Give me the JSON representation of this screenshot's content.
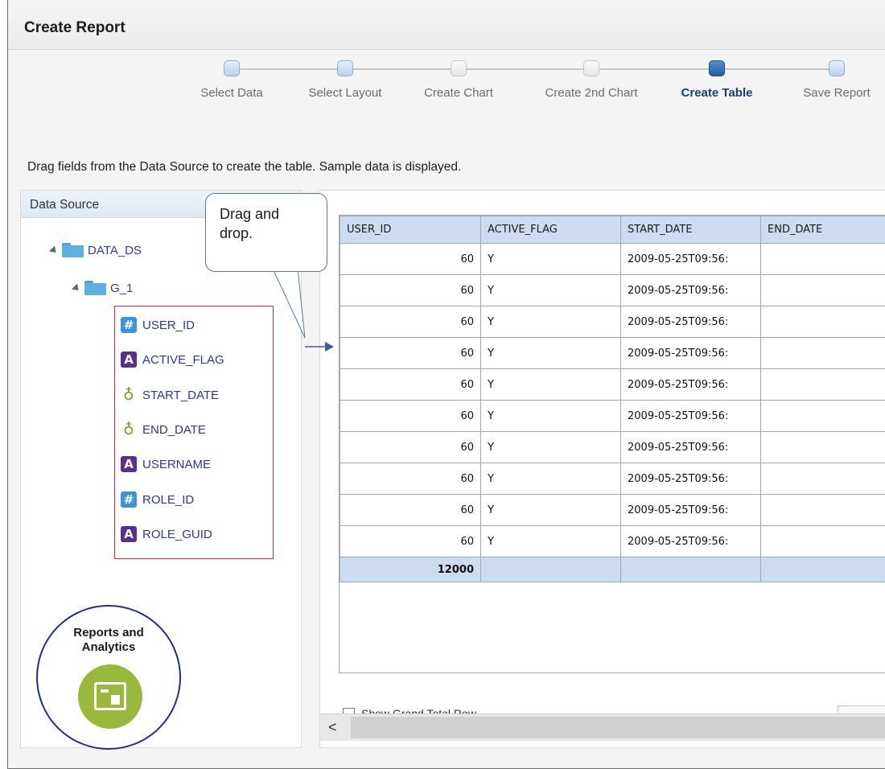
{
  "page": {
    "title": "Create Report"
  },
  "train": {
    "stops": [
      {
        "label": "Select Data",
        "state": "visited"
      },
      {
        "label": "Select Layout",
        "state": "visited"
      },
      {
        "label": "Create Chart",
        "state": "inactive"
      },
      {
        "label": "Create 2nd Chart",
        "state": "inactive"
      },
      {
        "label": "Create Table",
        "state": "current"
      },
      {
        "label": "Save Report",
        "state": "visited"
      }
    ]
  },
  "instructions": "Drag fields from the Data Source to create the table. Sample data is displayed.",
  "data_source": {
    "header": "Data Source",
    "root": "DATA_DS",
    "group": "G_1",
    "fields": [
      {
        "name": "USER_ID",
        "type": "number",
        "icon": "number-icon",
        "glyph": "#"
      },
      {
        "name": "ACTIVE_FLAG",
        "type": "text",
        "icon": "text-icon",
        "glyph": "A"
      },
      {
        "name": "START_DATE",
        "type": "date",
        "icon": "date-icon",
        "glyph": "♁"
      },
      {
        "name": "END_DATE",
        "type": "date",
        "icon": "date-icon",
        "glyph": "♁"
      },
      {
        "name": "USERNAME",
        "type": "text",
        "icon": "text-icon",
        "glyph": "A"
      },
      {
        "name": "ROLE_ID",
        "type": "number",
        "icon": "number-icon",
        "glyph": "#"
      },
      {
        "name": "ROLE_GUID",
        "type": "text",
        "icon": "text-icon",
        "glyph": "A"
      }
    ]
  },
  "callout": {
    "line1": "Drag and",
    "line2": "drop."
  },
  "badge": {
    "line1": "Reports and",
    "line2": "Analytics"
  },
  "table": {
    "columns": [
      "USER_ID",
      "ACTIVE_FLAG",
      "START_DATE",
      "END_DATE"
    ],
    "rows": [
      [
        "60",
        "Y",
        "2009-05-25T09:56:",
        ""
      ],
      [
        "60",
        "Y",
        "2009-05-25T09:56:",
        ""
      ],
      [
        "60",
        "Y",
        "2009-05-25T09:56:",
        ""
      ],
      [
        "60",
        "Y",
        "2009-05-25T09:56:",
        ""
      ],
      [
        "60",
        "Y",
        "2009-05-25T09:56:",
        ""
      ],
      [
        "60",
        "Y",
        "2009-05-25T09:56:",
        ""
      ],
      [
        "60",
        "Y",
        "2009-05-25T09:56:",
        ""
      ],
      [
        "60",
        "Y",
        "2009-05-25T09:56:",
        ""
      ],
      [
        "60",
        "Y",
        "2009-05-25T09:56:",
        ""
      ],
      [
        "60",
        "Y",
        "2009-05-25T09:56:",
        ""
      ]
    ],
    "total": [
      "12000",
      "",
      "",
      ""
    ],
    "show_grand_total_label": "Show Grand Total Row"
  },
  "scroll": {
    "left_arrow": "<"
  },
  "colors": {
    "accent": "#1b3f7d",
    "header_fill": "#cddcf0",
    "highlight_border": "#c8343a",
    "badge_green": "#9ab93c"
  }
}
